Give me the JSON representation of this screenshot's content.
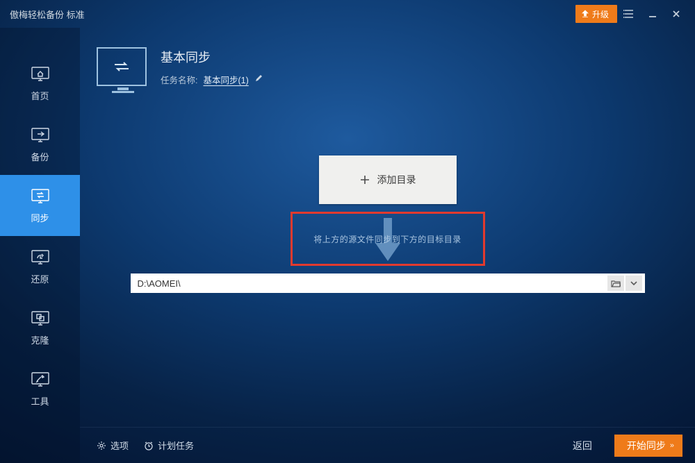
{
  "titlebar": {
    "app_title": "傲梅轻松备份 标准",
    "upgrade_label": "升级"
  },
  "sidebar": {
    "items": [
      {
        "label": "首页"
      },
      {
        "label": "备份"
      },
      {
        "label": "同步"
      },
      {
        "label": "还原"
      },
      {
        "label": "克隆"
      },
      {
        "label": "工具"
      }
    ]
  },
  "header": {
    "title": "基本同步",
    "task_label": "任务名称:",
    "task_name": "基本同步(1)"
  },
  "center": {
    "add_label": "添加目录",
    "arrow_hint": "将上方的源文件同步到下方的目标目录",
    "dest_path": "D:\\AOMEI\\"
  },
  "footer": {
    "options_label": "选项",
    "schedule_label": "计划任务",
    "back_label": "返回",
    "start_label": "开始同步"
  }
}
